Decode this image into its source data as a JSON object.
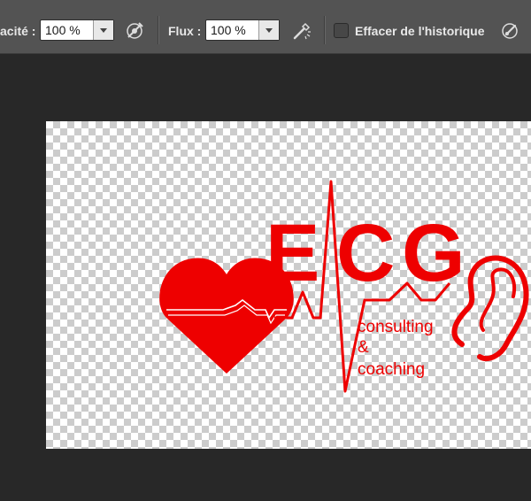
{
  "options_bar": {
    "opacity_label": "acité :",
    "opacity_value": "100 %",
    "flow_label": "Flux :",
    "flow_value": "100 %",
    "erase_history_label": "Effacer de l'historique",
    "erase_history_checked": false
  },
  "icons": {
    "opacity_pressure": "airbrush-pressure-icon",
    "flow_airbrush": "airbrush-icon",
    "pressure_size": "tablet-pressure-icon"
  },
  "artwork": {
    "letters": [
      "E",
      "C",
      "G"
    ],
    "tagline_1": "consulting",
    "tagline_2": "&",
    "tagline_3": "coaching",
    "brand_color": "#ee0000"
  },
  "colors": {
    "toolbar_bg": "#535353",
    "workspace_bg": "#282828"
  }
}
